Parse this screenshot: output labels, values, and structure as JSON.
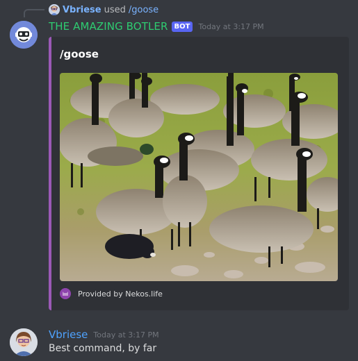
{
  "interaction": {
    "user": "Vbriese",
    "used_text": "used",
    "command": "/goose",
    "avatar_icon": "user-avatar-icon"
  },
  "bot_message": {
    "author": "THE AMAZING BOTLER",
    "tag": "BOT",
    "timestamp": "Today at 3:17 PM",
    "avatar_icon": "bot-avatar-icon",
    "author_color": "#2ecc71",
    "embed": {
      "accent_color": "#9b59b6",
      "title": "/goose",
      "image_icon": "canada-geese-photo",
      "footer_icon": "nekos-life-icon",
      "footer_text": "Provided by Nekos.life"
    }
  },
  "user_message": {
    "author": "Vbriese",
    "timestamp": "Today at 3:17 PM",
    "avatar_icon": "user-avatar-icon",
    "author_color": "#4fa3ff",
    "content": "Best command, by far"
  }
}
